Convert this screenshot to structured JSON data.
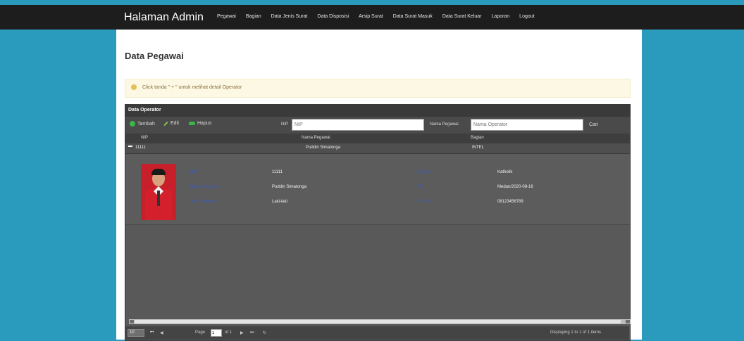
{
  "navbar": {
    "brand": "Halaman Admin",
    "items": [
      "Pegawai",
      "Bagian",
      "Data Jenis Surat",
      "Data Disposisi",
      "Arsip Surat",
      "Data Surat Masuk",
      "Data Surat Keluar",
      "Laporan",
      "Logout"
    ]
  },
  "page": {
    "title": "Data Pegawai",
    "alert": "Click tanda \" + \" untuk melihat detail Operator"
  },
  "grid": {
    "panel_title": "Data Operator",
    "toolbar": {
      "tambah": "Tambah",
      "edit": "Edit",
      "hapus": "Hapus",
      "nip_label": "NIP",
      "nip_placeholder": "NIP",
      "nama_label": "Nama Pegawai",
      "nama_placeholder": "Nama Operator",
      "cari": "Cari"
    },
    "columns": [
      "NIP",
      "Nama Pegawai",
      "Bagian"
    ],
    "rows": [
      {
        "nip": "11111",
        "nama": "Puddin Simatonga",
        "bagian": "INTEL"
      }
    ],
    "detail": {
      "nip_label": "NIP",
      "nip_value": "11111",
      "nama_label": "Nama Pegawai",
      "nama_value": "Puddin Simatonga",
      "jk_label": "Jenis Kelamin",
      "jk_value": "Laki-laki",
      "agama_label": "Agama",
      "agama_value": "Katholik",
      "ttl_label": "TTL",
      "ttl_value": "Medan/2020-08-16",
      "hp_label": "No. HP",
      "hp_value": "08123456789"
    },
    "pager": {
      "page_size": "10",
      "page_label": "Page",
      "page_value": "1",
      "of_label": "of 1",
      "displaying": "Displaying 1 to 1 of 1 items"
    }
  }
}
